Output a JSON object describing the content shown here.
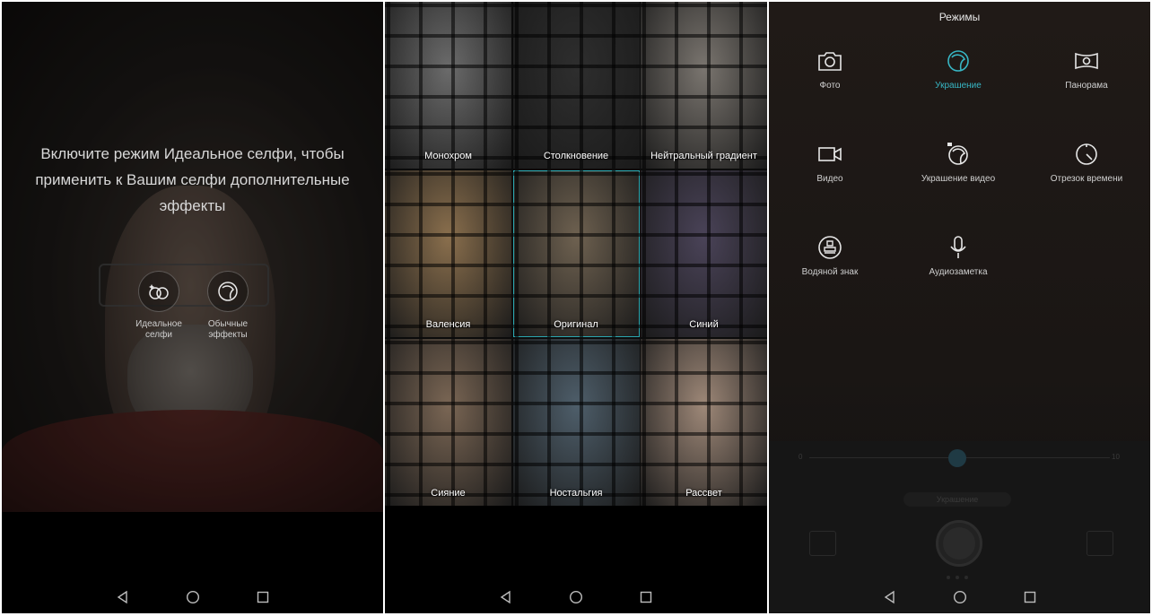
{
  "panel1": {
    "message": "Включите режим Идеальное селфи, чтобы применить к Вашим селфи дополнительные эффекты",
    "buttons": [
      {
        "label_line1": "Идеальное",
        "label_line2": "селфи",
        "icon": "perfect-selfie-icon"
      },
      {
        "label_line1": "Обычные",
        "label_line2": "эффекты",
        "icon": "beauty-effects-icon"
      }
    ]
  },
  "panel2": {
    "filters": [
      {
        "label": "Монохром",
        "tone": "#6b6b6b"
      },
      {
        "label": "Столкновение",
        "tone": "#2e2e2e"
      },
      {
        "label": "Нейтральный градиент",
        "tone": "#7a756f"
      },
      {
        "label": "Валенсия",
        "tone": "#8a6f4d"
      },
      {
        "label": "Оригинал",
        "tone": "#6e6150"
      },
      {
        "label": "Синий",
        "tone": "#4a4358"
      },
      {
        "label": "Сияние",
        "tone": "#7a6654"
      },
      {
        "label": "Ностальгия",
        "tone": "#4e5e6a"
      },
      {
        "label": "Рассвет",
        "tone": "#9e8878"
      }
    ],
    "selected": "Оригинал",
    "selected_color": "#2aa7b0"
  },
  "panel3": {
    "title": "Режимы",
    "accent": "#37b6c4",
    "modes": [
      {
        "label": "Фото",
        "icon": "camera-icon"
      },
      {
        "label": "Украшение",
        "icon": "beauty-icon",
        "active": true
      },
      {
        "label": "Панорама",
        "icon": "panorama-icon"
      },
      {
        "label": "Видео",
        "icon": "video-icon"
      },
      {
        "label": "Украшение видео",
        "icon": "beauty-video-icon"
      },
      {
        "label": "Отрезок времени",
        "icon": "timelapse-icon"
      },
      {
        "label": "Водяной знак",
        "icon": "watermark-icon"
      },
      {
        "label": "Аудиозаметка",
        "icon": "microphone-icon"
      }
    ],
    "slider_min": "0",
    "slider_max": "10",
    "faint_chip": "Украшение"
  },
  "navbar": {
    "back": "back-icon",
    "home": "home-icon",
    "recents": "recents-icon"
  }
}
